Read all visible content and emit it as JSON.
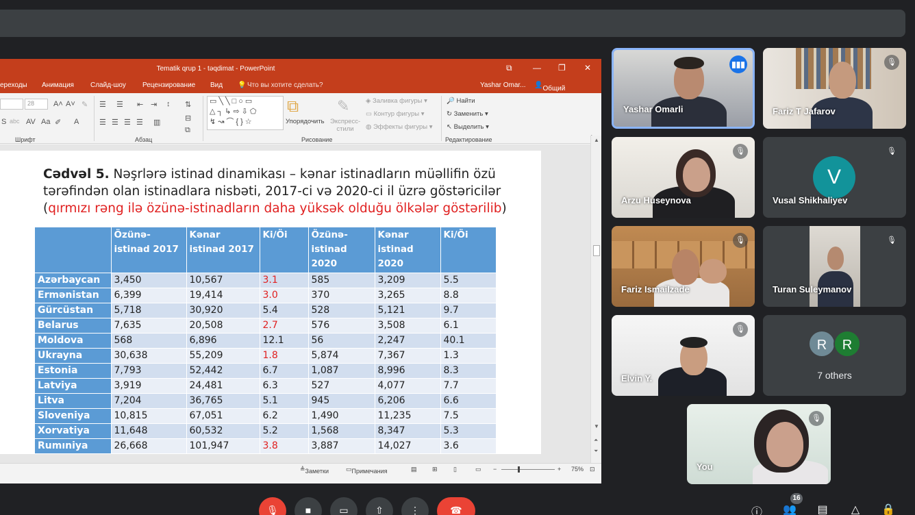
{
  "window": {
    "title": "Tematik qrup 1 - təqdimat - PowerPoint",
    "controls": {
      "restore_ribbon": "⧉",
      "minimize": "—",
      "maximize": "❐",
      "close": "✕"
    },
    "tabs": [
      "ереходы",
      "Анимация",
      "Слайд-шоу",
      "Рецензирование",
      "Вид"
    ],
    "tell_me": "Что вы хотите сделать?",
    "user": "Yashar Omar...",
    "share": "Общий доступ"
  },
  "ribbon": {
    "font_size": "28",
    "groups": {
      "font": "Шрифт",
      "paragraph": "Абзац",
      "drawing": "Рисование",
      "editing": "Редактирование"
    },
    "arrange": "Упорядочить",
    "quick_styles": "Экспресс-стили",
    "shape_fill": "Заливка фигуры",
    "shape_outline": "Контур фигуры",
    "shape_effects": "Эффекты фигуры",
    "find": "Найти",
    "replace": "Заменить",
    "select": "Выделить"
  },
  "slide": {
    "heading_bold": "Cədvəl 5.",
    "heading_rest": " Nəşrlərə istinad dinamikası – kənar istinadların müəllifin özü tərəfindən olan istinadlara nisbəti, 2017-ci və 2020-ci il üzrə göstəricilər",
    "heading_open_paren": "(",
    "heading_red": "qırmızı rəng ilə özünə-istinadların daha yüksək olduğu ölkələr göstərilib",
    "heading_close_paren": ")",
    "table": {
      "headers": [
        "",
        "Özünə-istinad 2017",
        "Kənar istinad 2017",
        "Ki/Öi",
        "Özünə-istinad 2020",
        "Kənar istinad 2020",
        "Ki/Öi"
      ],
      "rows": [
        [
          "Azərbaycan",
          "3,450",
          "10,567",
          "3.1",
          "585",
          "3,209",
          "5.5"
        ],
        [
          "Ermənistan",
          "6,399",
          "19,414",
          "3.0",
          "370",
          "3,265",
          "8.8"
        ],
        [
          "Gürcüstan",
          "5,718",
          "30,920",
          "5.4",
          "528",
          "5,121",
          "9.7"
        ],
        [
          "Belarus",
          "7,635",
          "20,508",
          "2.7",
          "576",
          "3,508",
          "6.1"
        ],
        [
          "Moldova",
          "568",
          "6,896",
          "12.1",
          "56",
          "2,247",
          "40.1"
        ],
        [
          "Ukrayna",
          "30,638",
          "55,209",
          "1.8",
          "5,874",
          "7,367",
          "1.3"
        ],
        [
          "Estonia",
          "7,793",
          "52,442",
          "6.7",
          "1,087",
          "8,996",
          "8.3"
        ],
        [
          "Latviya",
          "3,919",
          "24,481",
          "6.3",
          "527",
          "4,077",
          "7.7"
        ],
        [
          "Litva",
          "7,204",
          "36,765",
          "5.1",
          "945",
          "6,206",
          "6.6"
        ],
        [
          "Sloveniya",
          "10,815",
          "67,051",
          "6.2",
          "1,490",
          "11,235",
          "7.5"
        ],
        [
          "Xorvatiya",
          "11,648",
          "60,532",
          "5.2",
          "1,568",
          "8,347",
          "5.3"
        ],
        [
          "Rumıniya",
          "26,668",
          "101,947",
          "3.8",
          "3,887",
          "14,027",
          "3.6"
        ]
      ],
      "red_rows": [
        0,
        1,
        3,
        5,
        11
      ]
    }
  },
  "statusbar": {
    "notes": "Заметки",
    "comments": "Примечания",
    "zoom": "75%"
  },
  "participants": {
    "p1": "Yashar Omarli",
    "p2": "Fariz T Jafarov",
    "p3": "Arzu Huseynova",
    "p4": "Vusal Shikhaliyev",
    "p4_initial": "V",
    "p5": "Fariz Ismailzade",
    "p6": "Turan Suleymanov",
    "p7": "Elvin Y.",
    "others_label": "7 others",
    "others_initials": [
      "R",
      "R"
    ],
    "self": "You"
  },
  "controls": {
    "people_count": "16"
  },
  "colors": {
    "accent": "#1a73e8",
    "ppt": "#c43e1c",
    "table_header": "#5b9bd5",
    "hangup": "#ea4335"
  }
}
